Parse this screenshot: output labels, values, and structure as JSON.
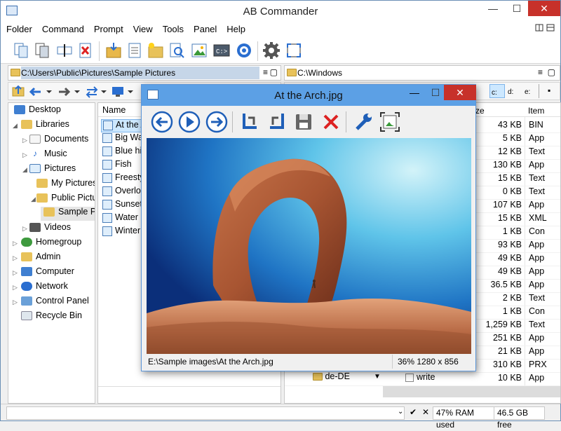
{
  "app": {
    "title": "AB Commander",
    "min": "—",
    "max": "☐",
    "close": "✕"
  },
  "menu": [
    "Folder",
    "Command",
    "Prompt",
    "View",
    "Tools",
    "Panel",
    "Help"
  ],
  "left_panel": {
    "path": "C:\\Users\\Public\\Pictures\\Sample Pictures",
    "tree": [
      {
        "label": "Desktop",
        "icon": "desktop-icon"
      },
      {
        "label": "Libraries",
        "icon": "libraries-icon"
      },
      {
        "label": "Documents",
        "icon": "documents-icon"
      },
      {
        "label": "Music",
        "icon": "music-icon"
      },
      {
        "label": "Pictures",
        "icon": "pictures-icon"
      },
      {
        "label": "My Pictures",
        "icon": "folder-icon"
      },
      {
        "label": "Public Pictu",
        "icon": "folder-icon"
      },
      {
        "label": "Sample Pi",
        "icon": "folder-icon"
      },
      {
        "label": "Videos",
        "icon": "videos-icon"
      },
      {
        "label": "Homegroup",
        "icon": "homegroup-icon"
      },
      {
        "label": "Admin",
        "icon": "user-folder-icon"
      },
      {
        "label": "Computer",
        "icon": "computer-icon"
      },
      {
        "label": "Network",
        "icon": "network-icon"
      },
      {
        "label": "Control Panel",
        "icon": "control-panel-icon"
      },
      {
        "label": "Recycle Bin",
        "icon": "recycle-bin-icon"
      }
    ],
    "list_header": "Name",
    "files": [
      "At the A",
      "Big Wa",
      "Blue hi",
      "Fish",
      "Freesty",
      "Overlo",
      "Sunset",
      "Water l",
      "Winter"
    ]
  },
  "right_panel": {
    "path": "C:\\Windows",
    "drives": [
      "c:",
      "d:",
      "e:"
    ],
    "header_size": "ze",
    "header_type": "Item",
    "rows": [
      {
        "size": "43 KB",
        "type": "BIN"
      },
      {
        "size": "5 KB",
        "type": "App"
      },
      {
        "size": "12 KB",
        "type": "Text"
      },
      {
        "size": "130 KB",
        "type": "App"
      },
      {
        "size": "15 KB",
        "type": "Text"
      },
      {
        "size": "0 KB",
        "type": "Text"
      },
      {
        "size": "107 KB",
        "type": "App"
      },
      {
        "size": "15 KB",
        "type": "XML"
      },
      {
        "size": "1 KB",
        "type": "Con"
      },
      {
        "size": "93 KB",
        "type": "App"
      },
      {
        "size": "49 KB",
        "type": "App"
      },
      {
        "size": "49 KB",
        "type": "App"
      },
      {
        "size": "36.5 KB",
        "type": "App"
      },
      {
        "size": "2 KB",
        "type": "Text"
      },
      {
        "size": "1 KB",
        "type": "Con"
      },
      {
        "size": "1,259 KB",
        "type": "Text"
      },
      {
        "size": "251 KB",
        "type": "App"
      },
      {
        "size": "21 KB",
        "type": "App"
      },
      {
        "size": "310 KB",
        "type": "PRX"
      },
      {
        "size": "10 KB",
        "type": "App"
      }
    ],
    "partial_folder": "de-DE",
    "write_item": "write"
  },
  "status": {
    "ram": "47% RAM used",
    "free": "46.5 GB free",
    "check": "✔",
    "close": "✕"
  },
  "viewer": {
    "title": "At the Arch.jpg",
    "path": "E:\\Sample images\\At the Arch.jpg",
    "info": "36% 1280 x 856",
    "close": "✕",
    "min": "—",
    "max": "☐"
  },
  "colors": {
    "accent": "#5ca0e5",
    "selection": "#cde8ff",
    "path_selected": "#c6d6e8",
    "close_red": "#c7312a"
  }
}
